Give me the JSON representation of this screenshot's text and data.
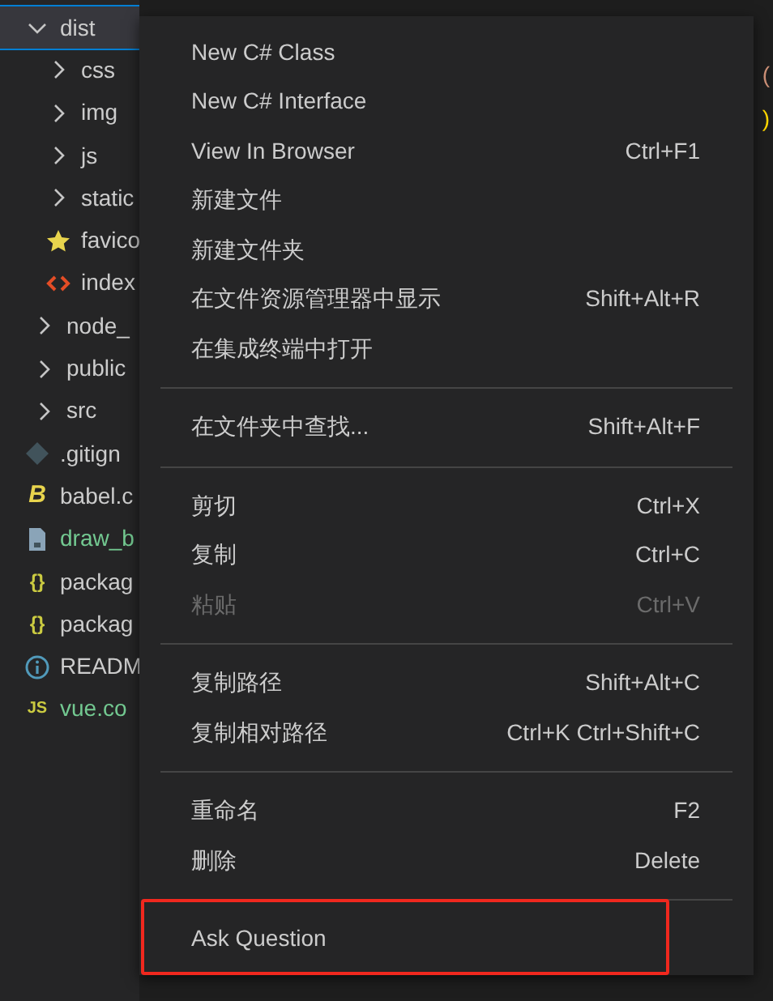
{
  "explorer": {
    "tree": [
      {
        "label": "dist",
        "kind": "folder",
        "expanded": true,
        "selected": true,
        "untracked": false,
        "children": [
          {
            "label": "css",
            "kind": "folder",
            "expanded": false,
            "selected": false,
            "untracked": false
          },
          {
            "label": "img",
            "kind": "folder",
            "expanded": false,
            "selected": false,
            "untracked": false
          },
          {
            "label": "js",
            "kind": "folder",
            "expanded": false,
            "selected": false,
            "untracked": false
          },
          {
            "label": "static",
            "kind": "folder",
            "expanded": false,
            "selected": false,
            "untracked": false
          },
          {
            "label": "favico",
            "kind": "star",
            "selected": false,
            "untracked": false
          },
          {
            "label": "index",
            "kind": "html",
            "selected": false,
            "untracked": false
          }
        ]
      },
      {
        "label": "node_",
        "kind": "folder",
        "expanded": false,
        "selected": false,
        "untracked": false
      },
      {
        "label": "public",
        "kind": "folder",
        "expanded": false,
        "selected": false,
        "untracked": false
      },
      {
        "label": "src",
        "kind": "folder",
        "expanded": false,
        "selected": false,
        "untracked": false
      },
      {
        "label": ".gitign",
        "kind": "git",
        "selected": false,
        "untracked": false
      },
      {
        "label": "babel.c",
        "kind": "babel",
        "icon_text": "B",
        "selected": false,
        "untracked": false
      },
      {
        "label": "draw_b",
        "kind": "image",
        "selected": false,
        "untracked": true
      },
      {
        "label": "packag",
        "kind": "json",
        "icon_text": "{}",
        "selected": false,
        "untracked": false
      },
      {
        "label": "packag",
        "kind": "json",
        "icon_text": "{}",
        "selected": false,
        "untracked": false
      },
      {
        "label": "READM",
        "kind": "info",
        "selected": false,
        "untracked": false
      },
      {
        "label": "vue.co",
        "kind": "js",
        "icon_text": "JS",
        "selected": false,
        "untracked": true
      }
    ]
  },
  "editor": {
    "lines": [
      "(",
      ")"
    ]
  },
  "context_menu": {
    "groups": [
      [
        {
          "label": "New C# Class",
          "disabled": false,
          "highlighted": false
        },
        {
          "label": "New C# Interface",
          "disabled": false,
          "highlighted": false
        },
        {
          "label": "View In Browser",
          "shortcut": "Ctrl+F1",
          "disabled": false,
          "highlighted": false
        },
        {
          "label": "新建文件",
          "disabled": false,
          "highlighted": false
        },
        {
          "label": "新建文件夹",
          "disabled": false,
          "highlighted": false
        },
        {
          "label": "在文件资源管理器中显示",
          "shortcut": "Shift+Alt+R",
          "disabled": false,
          "highlighted": false
        },
        {
          "label": "在集成终端中打开",
          "disabled": false,
          "highlighted": false
        }
      ],
      [
        {
          "label": "在文件夹中查找...",
          "shortcut": "Shift+Alt+F",
          "disabled": false,
          "highlighted": false
        }
      ],
      [
        {
          "label": "剪切",
          "shortcut": "Ctrl+X",
          "disabled": false,
          "highlighted": false
        },
        {
          "label": "复制",
          "shortcut": "Ctrl+C",
          "disabled": false,
          "highlighted": false
        },
        {
          "label": "粘贴",
          "shortcut": "Ctrl+V",
          "disabled": true,
          "highlighted": false
        }
      ],
      [
        {
          "label": "复制路径",
          "shortcut": "Shift+Alt+C",
          "disabled": false,
          "highlighted": false
        },
        {
          "label": "复制相对路径",
          "shortcut": "Ctrl+K Ctrl+Shift+C",
          "disabled": false,
          "highlighted": false
        }
      ],
      [
        {
          "label": "重命名",
          "shortcut": "F2",
          "disabled": false,
          "highlighted": false
        },
        {
          "label": "删除",
          "shortcut": "Delete",
          "disabled": false,
          "highlighted": false
        }
      ],
      [
        {
          "label": "Ask Question",
          "disabled": false,
          "highlighted": true
        }
      ]
    ]
  }
}
